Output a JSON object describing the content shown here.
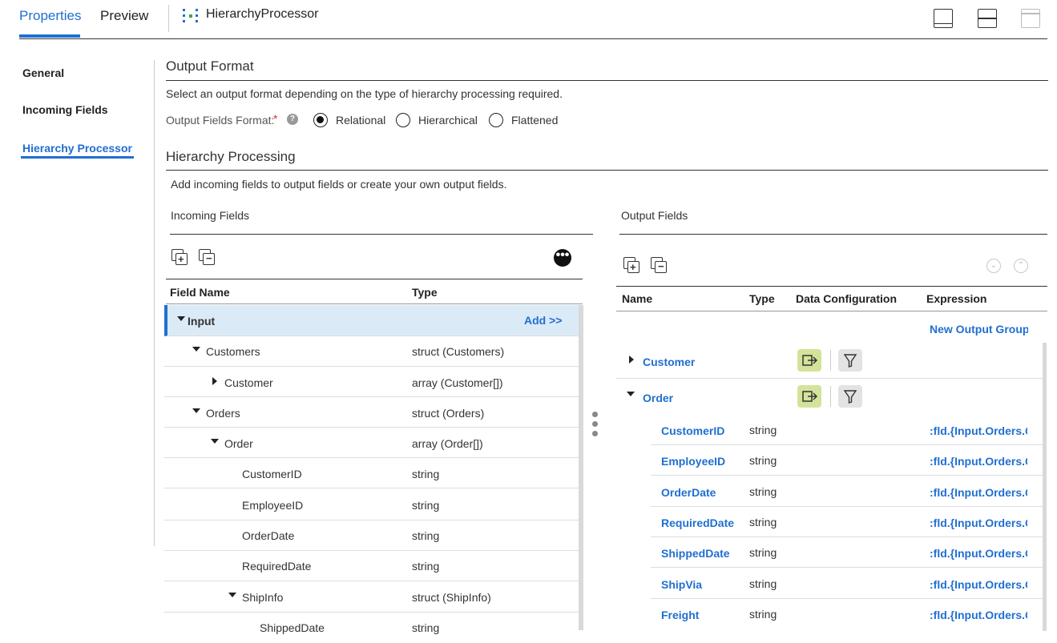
{
  "tabs": {
    "properties": "Properties",
    "preview": "Preview"
  },
  "app_title": "HierarchyProcessor",
  "nav": {
    "general": "General",
    "incoming_fields": "Incoming Fields",
    "hierarchy_processor": "Hierarchy Processor"
  },
  "output_format": {
    "title": "Output Format",
    "description": "Select an output format depending on the type of hierarchy processing required.",
    "fields_format_label": "Output Fields Format:",
    "required_mark": "*",
    "help_glyph": "?",
    "options": [
      "Relational",
      "Hierarchical",
      "Flattened"
    ],
    "selected": "Relational"
  },
  "hierarchy_processing": {
    "title": "Hierarchy Processing",
    "description": "Add incoming fields to output fields or create your own output fields."
  },
  "incoming": {
    "title": "Incoming Fields",
    "columns": {
      "name": "Field Name",
      "type": "Type"
    },
    "add_label": "Add >>",
    "rows": [
      {
        "name": "Input",
        "type": ""
      },
      {
        "name": "Customers",
        "type": "struct (Customers)"
      },
      {
        "name": "Customer",
        "type": "array (Customer[])"
      },
      {
        "name": "Orders",
        "type": "struct (Orders)"
      },
      {
        "name": "Order",
        "type": "array (Order[])"
      },
      {
        "name": "CustomerID",
        "type": "string"
      },
      {
        "name": "EmployeeID",
        "type": "string"
      },
      {
        "name": "OrderDate",
        "type": "string"
      },
      {
        "name": "RequiredDate",
        "type": "string"
      },
      {
        "name": "ShipInfo",
        "type": "struct (ShipInfo)"
      },
      {
        "name": "ShippedDate",
        "type": "string"
      }
    ]
  },
  "output": {
    "title": "Output Fields",
    "columns": {
      "name": "Name",
      "type": "Type",
      "config": "Data Configuration",
      "expression": "Expression"
    },
    "new_group": "New Output Group",
    "groups": [
      {
        "name": "Customer"
      },
      {
        "name": "Order"
      }
    ],
    "rows": [
      {
        "name": "CustomerID",
        "type": "string",
        "expression": ":fld.{Input.Orders.C"
      },
      {
        "name": "EmployeeID",
        "type": "string",
        "expression": ":fld.{Input.Orders.C"
      },
      {
        "name": "OrderDate",
        "type": "string",
        "expression": ":fld.{Input.Orders.C"
      },
      {
        "name": "RequiredDate",
        "type": "string",
        "expression": ":fld.{Input.Orders.C"
      },
      {
        "name": "ShippedDate",
        "type": "string",
        "expression": ":fld.{Input.Orders.C"
      },
      {
        "name": "ShipVia",
        "type": "string",
        "expression": ":fld.{Input.Orders.C"
      },
      {
        "name": "Freight",
        "type": "string",
        "expression": ":fld.{Input.Orders.C"
      }
    ]
  },
  "colors": {
    "accent": "#1f6fd1",
    "selected_row": "#dbeaf7",
    "config_green": "#d4e39a",
    "config_gray": "#e3e3e3"
  }
}
